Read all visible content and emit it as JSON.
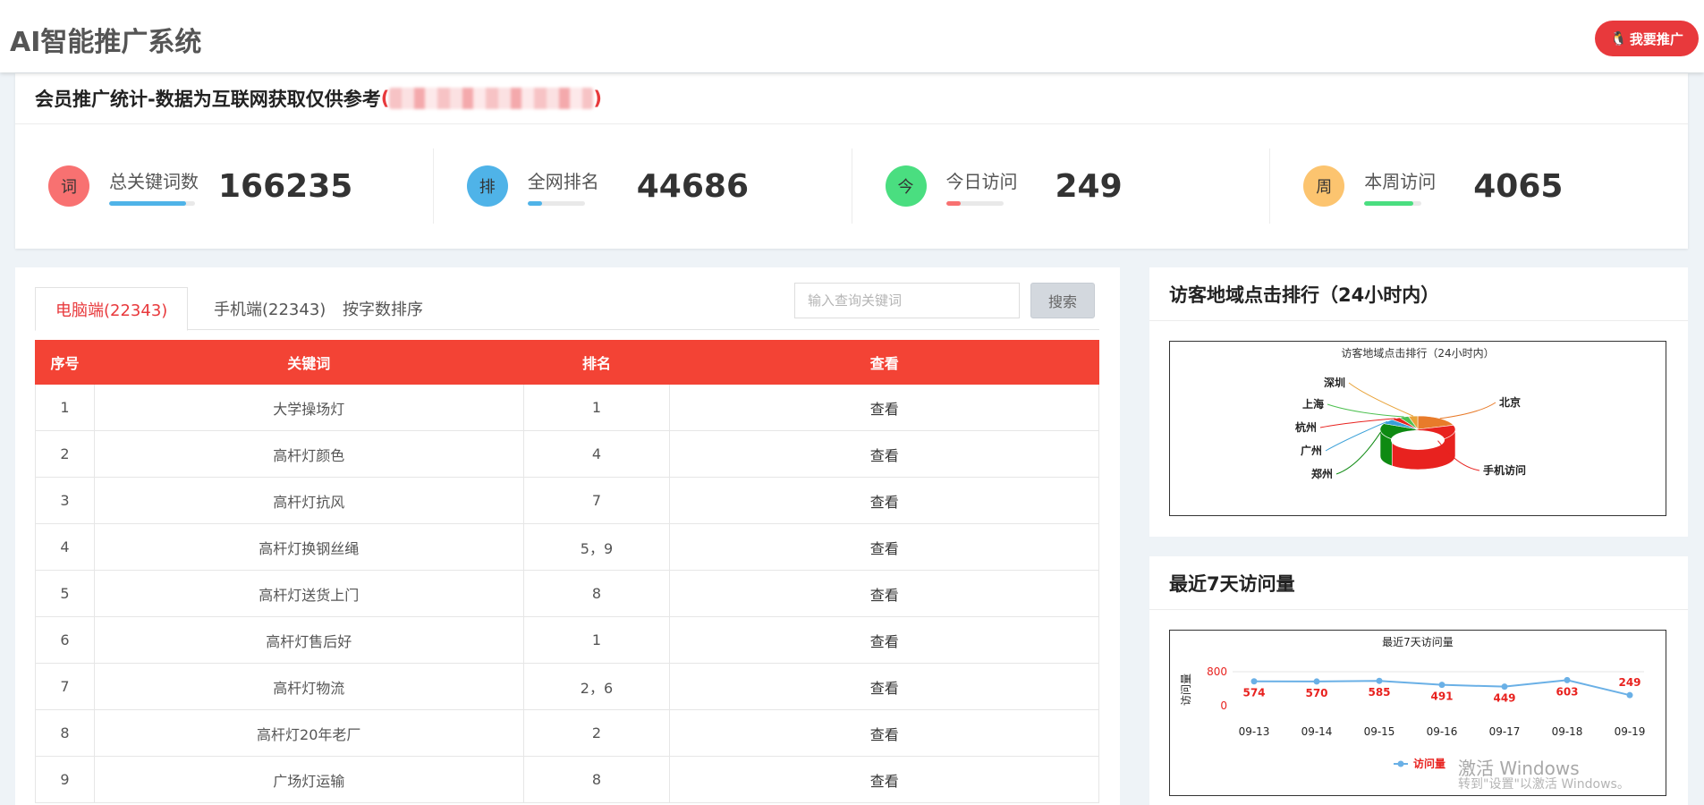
{
  "header": {
    "app_title": "AI智能推广系统",
    "promo_button_label": "我要推广",
    "promo_button_icon": "qq-penguin-icon"
  },
  "stats": {
    "title": "会员推广统计-数据为互联网获取仅供参考",
    "paren_open": "(",
    "paren_close": ")",
    "items": [
      {
        "icon_text": "词",
        "label": "总关键词数",
        "value": "166235",
        "color": "#f87171",
        "bar_color": "#4fb3e8",
        "bar_fraction": 0.9
      },
      {
        "icon_text": "排",
        "label": "全网排名",
        "value": "44686",
        "color": "#4fb3e8",
        "bar_color": "#4fb3e8",
        "bar_fraction": 0.25
      },
      {
        "icon_text": "今",
        "label": "今日访问",
        "value": "249",
        "color": "#4ade80",
        "bar_color": "#f87171",
        "bar_fraction": 0.25
      },
      {
        "icon_text": "周",
        "label": "本周访问",
        "value": "4065",
        "color": "#fcc46f",
        "bar_color": "#4ade80",
        "bar_fraction": 0.85
      }
    ]
  },
  "keywords": {
    "tabs": [
      "电脑端(22343)",
      "手机端(22343)",
      "按字数排序"
    ],
    "search_placeholder": "输入查询关键词",
    "search_button": "搜索",
    "headers": [
      "序号",
      "关键词",
      "排名",
      "查看"
    ],
    "rows": [
      {
        "no": "1",
        "keyword": "大学操场灯",
        "rank": "1",
        "view": "查看"
      },
      {
        "no": "2",
        "keyword": "高杆灯颜色",
        "rank": "4",
        "view": "查看"
      },
      {
        "no": "3",
        "keyword": "高杆灯抗风",
        "rank": "7",
        "view": "查看"
      },
      {
        "no": "4",
        "keyword": "高杆灯换钢丝绳",
        "rank": "5，9",
        "view": "查看"
      },
      {
        "no": "5",
        "keyword": "高杆灯送货上门",
        "rank": "8",
        "view": "查看"
      },
      {
        "no": "6",
        "keyword": "高杆灯售后好",
        "rank": "1",
        "view": "查看"
      },
      {
        "no": "7",
        "keyword": "高杆灯物流",
        "rank": "2，6",
        "view": "查看"
      },
      {
        "no": "8",
        "keyword": "高杆灯20年老厂",
        "rank": "2",
        "view": "查看"
      },
      {
        "no": "9",
        "keyword": "广场灯运输",
        "rank": "8",
        "view": "查看"
      }
    ]
  },
  "region_panel": {
    "title": "访客地域点击排行（24小时内）"
  },
  "visits_panel": {
    "title": "最近7天访问量"
  },
  "chart_data": [
    {
      "type": "pie",
      "title": "访客地域点击排行（24小时内）",
      "categories": [
        "北京",
        "手机访问",
        "郑州",
        "广州",
        "杭州",
        "上海",
        "深圳"
      ],
      "values": [
        20,
        42,
        20,
        6,
        4,
        4,
        4
      ],
      "colors": [
        "#e87b2a",
        "#e8221f",
        "#0e8a12",
        "#3aa0d8",
        "#e8221f",
        "#4cc04f",
        "#e8a33a"
      ],
      "legend": "none"
    },
    {
      "type": "line",
      "title": "最近7天访问量",
      "x": [
        "09-13",
        "09-14",
        "09-15",
        "09-16",
        "09-17",
        "09-18",
        "09-19"
      ],
      "series": [
        {
          "name": "访问量",
          "values": [
            574,
            570,
            585,
            491,
            449,
            603,
            249
          ]
        }
      ],
      "ylabel": "访问量",
      "ylim": [
        0,
        800
      ],
      "yticks": [
        "0",
        "800"
      ],
      "line_color": "#6ab0e6",
      "label_color": "#e8221f",
      "legend": "bottom-center",
      "grid": false
    }
  ],
  "watermark": {
    "line1": "激活 Windows",
    "line2": "转到\"设置\"以激活 Windows。"
  }
}
